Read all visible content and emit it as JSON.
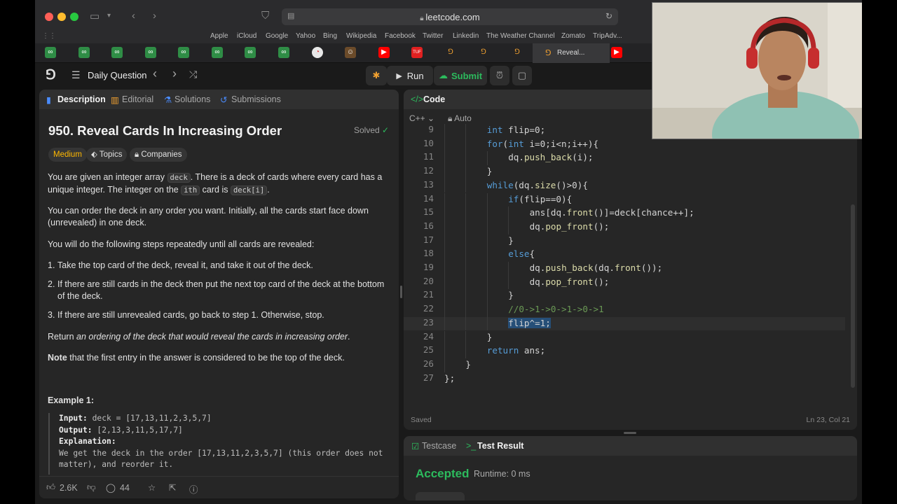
{
  "browser": {
    "url": "leetcode.com",
    "favorites": [
      "Apple",
      "iCloud",
      "Google",
      "Yahoo",
      "Bing",
      "Wikipedia",
      "Facebook",
      "Twitter",
      "Linkedin",
      "The Weather Channel",
      "Zomato",
      "TripAdv..."
    ],
    "active_tab_label": "Reveal..."
  },
  "nav": {
    "daily_question": "Daily Question",
    "run": "Run",
    "submit": "Submit"
  },
  "left_panel": {
    "tabs": [
      "Description",
      "Editorial",
      "Solutions",
      "Submissions"
    ],
    "problem_title": "950. Reveal Cards In Increasing Order",
    "status": "Solved",
    "difficulty": "Medium",
    "topics": "Topics",
    "companies": "Companies",
    "p1_a": "You are given an integer array",
    "p1_code1": "deck",
    "p1_b": ". There is a deck of cards where every card has a unique integer. The integer on the",
    "p1_code2": "ith",
    "p1_c": "card is",
    "p1_code3": "deck[i]",
    "p1_d": ".",
    "p2": "You can order the deck in any order you want. Initially, all the cards start face down (unrevealed) in one deck.",
    "p3": "You will do the following steps repeatedly until all cards are revealed:",
    "steps": [
      "Take the top card of the deck, reveal it, and take it out of the deck.",
      "If there are still cards in the deck then put the next top card of the deck at the bottom of the deck.",
      "If there are still unrevealed cards, go back to step 1. Otherwise, stop."
    ],
    "p4_a": "Return",
    "p4_em": "an ordering of the deck that would reveal the cards in increasing order",
    "p4_b": ".",
    "p5_bold": "Note",
    "p5_rest": "that the first entry in the answer is considered to be the top of the deck.",
    "example_title": "Example 1:",
    "ex_input_label": "Input:",
    "ex_input_val": "deck = [17,13,11,2,3,5,7]",
    "ex_output_label": "Output:",
    "ex_output_val": "[2,13,3,11,5,17,7]",
    "ex_expl_label": "Explanation:",
    "ex_expl_text": "We get the deck in the order [17,13,11,2,3,5,7] (this order does not matter), and reorder it.",
    "likes": "2.6K",
    "comments": "44"
  },
  "code_panel": {
    "tab": "Code",
    "language": "C++",
    "mode": "Auto",
    "saved": "Saved",
    "cursor_pos": "Ln 23, Col 21",
    "lines": [
      {
        "n": "9",
        "indent": 8,
        "parts": [
          [
            "kw",
            "int"
          ],
          [
            "txt",
            " flip=0;"
          ]
        ]
      },
      {
        "n": "10",
        "indent": 8,
        "parts": [
          [
            "kw",
            "for"
          ],
          [
            "txt",
            "("
          ],
          [
            "kw",
            "int"
          ],
          [
            "txt",
            " i=0;i<n;i++){"
          ]
        ]
      },
      {
        "n": "11",
        "indent": 12,
        "parts": [
          [
            "txt",
            "dq."
          ],
          [
            "fn",
            "push_back"
          ],
          [
            "txt",
            "(i);"
          ]
        ]
      },
      {
        "n": "12",
        "indent": 8,
        "parts": [
          [
            "txt",
            "}"
          ]
        ]
      },
      {
        "n": "13",
        "indent": 8,
        "parts": [
          [
            "kw",
            "while"
          ],
          [
            "txt",
            "(dq."
          ],
          [
            "fn",
            "size"
          ],
          [
            "txt",
            "()>0){"
          ]
        ]
      },
      {
        "n": "14",
        "indent": 12,
        "parts": [
          [
            "kw",
            "if"
          ],
          [
            "txt",
            "(flip==0){"
          ]
        ]
      },
      {
        "n": "15",
        "indent": 16,
        "parts": [
          [
            "txt",
            "ans[dq."
          ],
          [
            "fn",
            "front"
          ],
          [
            "txt",
            "()]=deck[chance++];"
          ]
        ]
      },
      {
        "n": "16",
        "indent": 16,
        "parts": [
          [
            "txt",
            "dq."
          ],
          [
            "fn",
            "pop_front"
          ],
          [
            "txt",
            "();"
          ]
        ]
      },
      {
        "n": "17",
        "indent": 12,
        "parts": [
          [
            "txt",
            "}"
          ]
        ]
      },
      {
        "n": "18",
        "indent": 12,
        "parts": [
          [
            "kw",
            "else"
          ],
          [
            "txt",
            "{"
          ]
        ]
      },
      {
        "n": "19",
        "indent": 16,
        "parts": [
          [
            "txt",
            "dq."
          ],
          [
            "fn",
            "push_back"
          ],
          [
            "txt",
            "(dq."
          ],
          [
            "fn",
            "front"
          ],
          [
            "txt",
            "());"
          ]
        ]
      },
      {
        "n": "20",
        "indent": 16,
        "parts": [
          [
            "txt",
            "dq."
          ],
          [
            "fn",
            "pop_front"
          ],
          [
            "txt",
            "();"
          ]
        ]
      },
      {
        "n": "21",
        "indent": 12,
        "parts": [
          [
            "txt",
            "}"
          ]
        ]
      },
      {
        "n": "22",
        "indent": 12,
        "parts": [
          [
            "cm",
            "//0->1->0->1->0->1"
          ]
        ]
      },
      {
        "n": "23",
        "indent": 12,
        "parts": [
          [
            "txt",
            "flip^=1;"
          ]
        ]
      },
      {
        "n": "24",
        "indent": 8,
        "parts": [
          [
            "txt",
            "}"
          ]
        ]
      },
      {
        "n": "25",
        "indent": 8,
        "parts": [
          [
            "kw",
            "return"
          ],
          [
            "txt",
            " ans;"
          ]
        ]
      },
      {
        "n": "26",
        "indent": 4,
        "parts": [
          [
            "txt",
            "}"
          ]
        ]
      },
      {
        "n": "27",
        "indent": 0,
        "parts": [
          [
            "txt",
            "};"
          ]
        ]
      }
    ]
  },
  "result_panel": {
    "testcase": "Testcase",
    "test_result": "Test Result",
    "status": "Accepted",
    "runtime": "Runtime: 0 ms"
  }
}
